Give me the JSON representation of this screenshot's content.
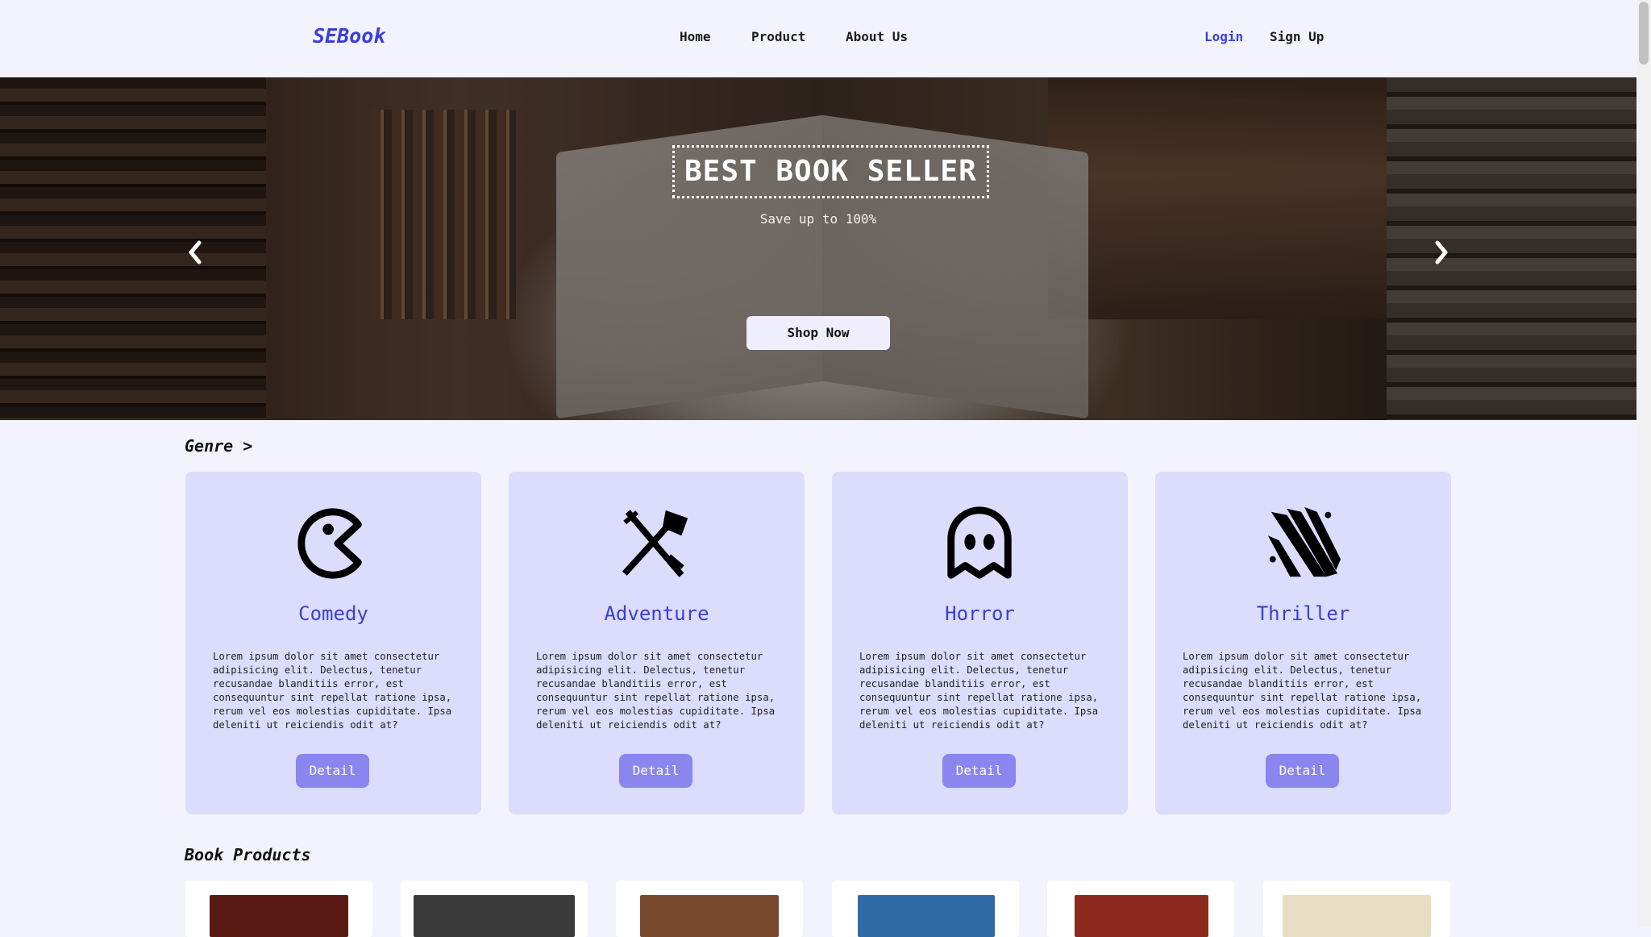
{
  "nav": {
    "brand": "SEBook",
    "links": [
      {
        "label": "Home"
      },
      {
        "label": "Product"
      },
      {
        "label": "About Us"
      }
    ],
    "login": "Login",
    "signup": "Sign Up",
    "colors": {
      "accent": "#3b3fd8",
      "background": "#f3f3fd"
    }
  },
  "hero": {
    "title": "BEST BOOK SELLER",
    "subtitle": "Save up to 100%",
    "cta": "Shop Now",
    "prev_icon": "chevron-left-icon",
    "next_icon": "chevron-right-icon"
  },
  "genre_section": {
    "title": "Genre >",
    "cards": [
      {
        "name": "Comedy",
        "icon": "pacman-icon",
        "description": "Lorem ipsum dolor sit amet consectetur adipisicing elit. Delectus, tenetur recusandae blanditiis error, est consequuntur sint repellat ratione ipsa, rerum vel eos molestias cupiditate. Ipsa deleniti ut reiciendis odit at?",
        "button": "Detail"
      },
      {
        "name": "Adventure",
        "icon": "crossed-swords-icon",
        "description": "Lorem ipsum dolor sit amet consectetur adipisicing elit. Delectus, tenetur recusandae blanditiis error, est consequuntur sint repellat ratione ipsa, rerum vel eos molestias cupiditate. Ipsa deleniti ut reiciendis odit at?",
        "button": "Detail"
      },
      {
        "name": "Horror",
        "icon": "ghost-icon",
        "description": "Lorem ipsum dolor sit amet consectetur adipisicing elit. Delectus, tenetur recusandae blanditiis error, est consequuntur sint repellat ratione ipsa, rerum vel eos molestias cupiditate. Ipsa deleniti ut reiciendis odit at?",
        "button": "Detail"
      },
      {
        "name": "Thriller",
        "icon": "claw-marks-icon",
        "description": "Lorem ipsum dolor sit amet consectetur adipisicing elit. Delectus, tenetur recusandae blanditiis error, est consequuntur sint repellat ratione ipsa, rerum vel eos molestias cupiditate. Ipsa deleniti ut reiciendis odit at?",
        "button": "Detail"
      }
    ],
    "colors": {
      "card": "#dcdcfc",
      "title": "#3a3fd1",
      "button": "#8b85ef"
    }
  },
  "products_section": {
    "title": "Book Products",
    "covers": [
      {
        "color": "#5a1a14"
      },
      {
        "color": "#3a3a3a"
      },
      {
        "color": "#7a4a2e"
      },
      {
        "color": "#2f6aa6"
      },
      {
        "color": "#8a2a1e"
      },
      {
        "color": "#e6ddc2"
      }
    ]
  }
}
